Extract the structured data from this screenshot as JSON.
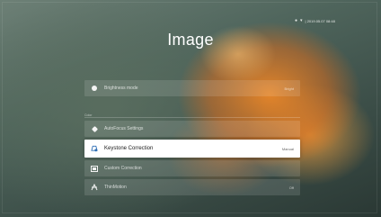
{
  "status_bar": {
    "signal_icon": "bluetooth-icon",
    "wifi_icon": "wifi-icon",
    "datetime": "| 2019.05.07  08:48"
  },
  "page": {
    "title": "Image"
  },
  "menu": {
    "section_label": "Color",
    "items": [
      {
        "label": "Brightness mode",
        "value": "Bright",
        "icon": "dot-icon",
        "selected": false
      },
      {
        "label": "AutoFocus Settings",
        "value": "",
        "icon": "focus-icon",
        "selected": false
      },
      {
        "label": "Keystone Correction",
        "value": "Manual",
        "icon": "keystone-icon",
        "selected": true
      },
      {
        "label": "Custom Correction",
        "value": "",
        "icon": "custom-correction-icon",
        "selected": false
      },
      {
        "label": "ThinMotion",
        "value": "Off",
        "icon": "motion-icon",
        "selected": false
      }
    ]
  },
  "colors": {
    "accent": "#2f6fb5",
    "selected_bg": "#ffffff",
    "row_bg": "rgba(255,255,255,0.12)"
  }
}
